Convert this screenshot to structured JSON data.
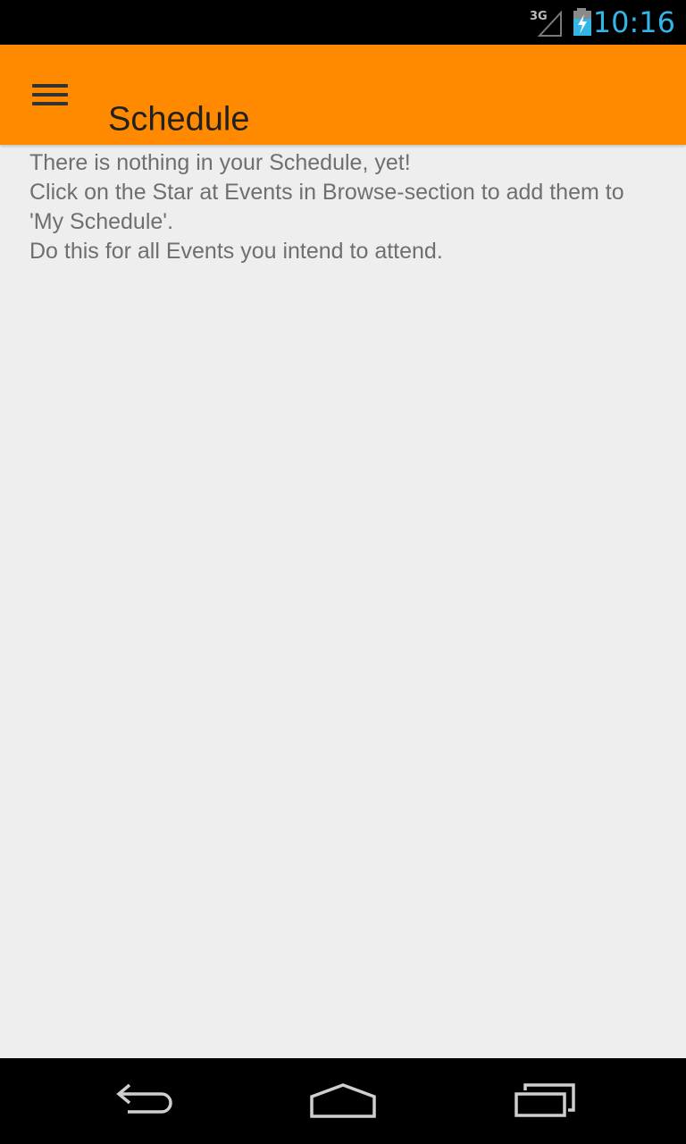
{
  "status_bar": {
    "network": "3G",
    "time": "10:16",
    "clock_color": "#33b5e5"
  },
  "app_bar": {
    "title": "Schedule",
    "background_color": "#ff8a00",
    "menu_icon": "hamburger-menu-icon"
  },
  "content": {
    "lines": [
      "There is nothing in your Schedule, yet!",
      "Click on the Star at Events in Browse-section to add them to 'My Schedule'.",
      "Do this for all Events you intend to attend."
    ]
  },
  "nav_bar": {
    "buttons": [
      {
        "name": "back",
        "icon": "back-arrow-icon"
      },
      {
        "name": "home",
        "icon": "home-icon"
      },
      {
        "name": "recents",
        "icon": "recent-apps-icon"
      }
    ]
  }
}
